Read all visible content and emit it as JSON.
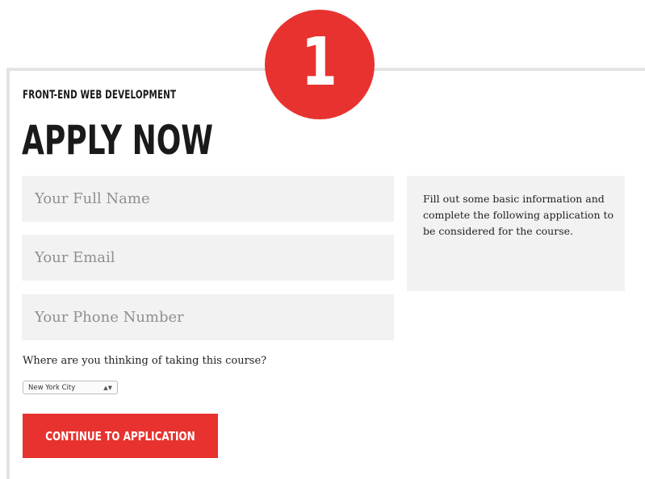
{
  "step_badge": {
    "number": "1"
  },
  "form": {
    "eyebrow": "FRONT-END WEB DEVELOPMENT",
    "title": "APPLY NOW",
    "name_placeholder": "Your Full Name",
    "email_placeholder": "Your Email",
    "phone_placeholder": "Your Phone Number",
    "location_question": "Where are you thinking of taking this course?",
    "location_selected": "New York City",
    "submit_label": "CONTINUE TO APPLICATION"
  },
  "info": {
    "text": "Fill out some basic information and complete the following application to be considered for the course."
  },
  "colors": {
    "accent": "#e8322f",
    "field_background": "#f2f2f2",
    "card_border": "#e4e4e4"
  }
}
